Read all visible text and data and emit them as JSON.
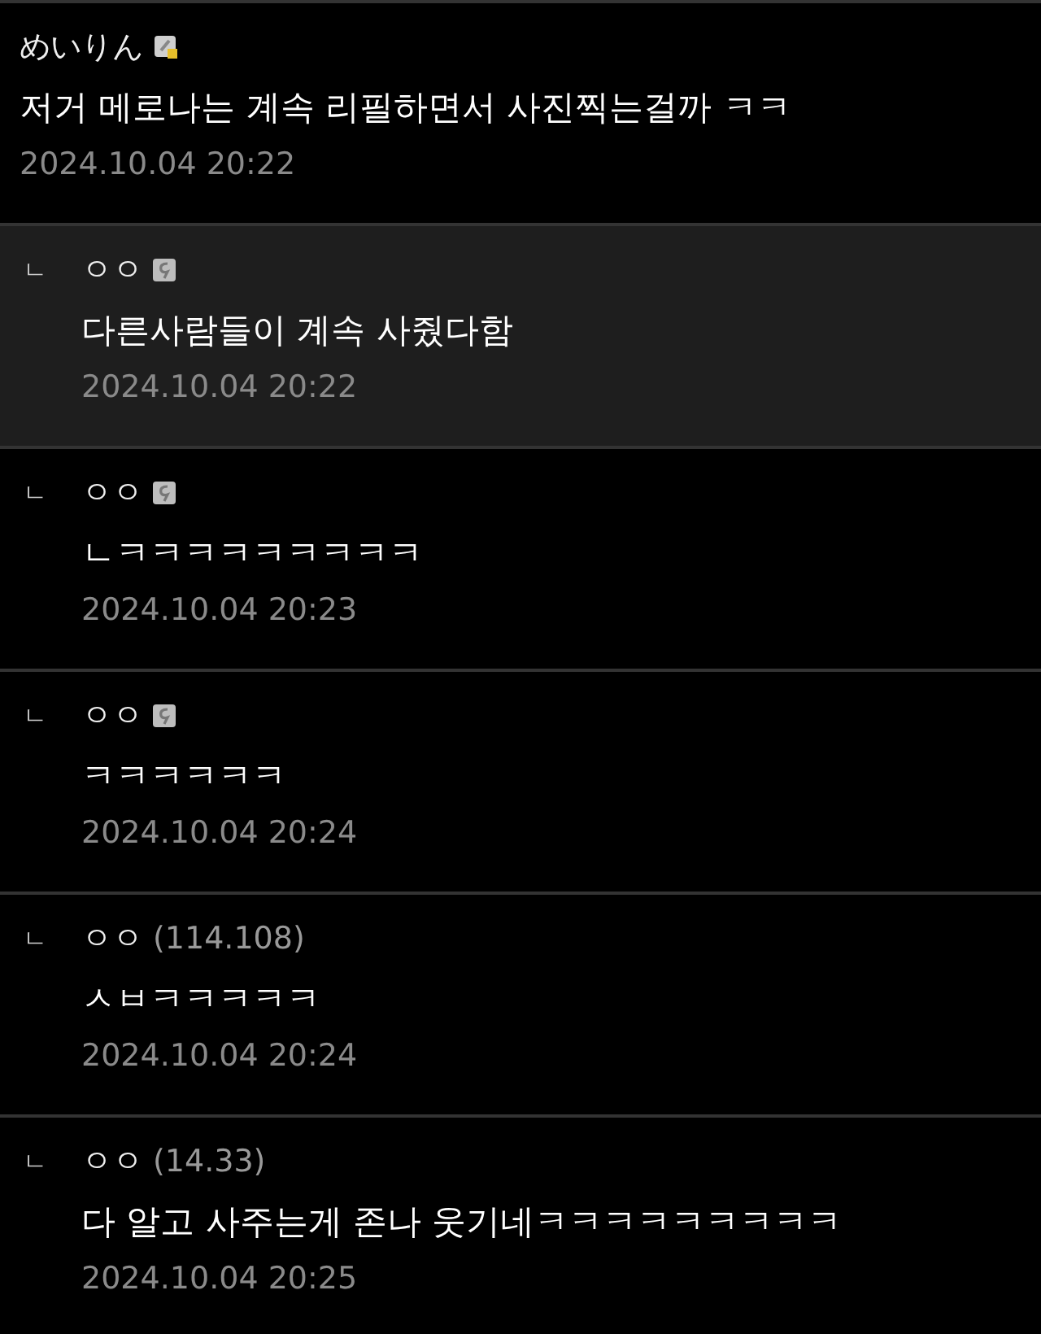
{
  "comment": {
    "nickname": "めいりん",
    "kind": "member",
    "text": "저거 메로나는 계속 리필하면서 사진찍는걸까 ㅋㅋ",
    "date": "2024.10.04 20:22",
    "highlighted": false,
    "children": [
      {
        "marker": "ㄴ",
        "nickname": "ㅇㅇ",
        "kind": "fixed",
        "text": "다른사람들이 계속 사줬다함",
        "date": "2024.10.04 20:22",
        "highlighted": true
      },
      {
        "marker": "ㄴ",
        "nickname": "ㅇㅇ",
        "kind": "fixed",
        "text": "ㄴㅋㅋㅋㅋㅋㅋㅋㅋㅋ",
        "date": "2024.10.04 20:23",
        "highlighted": false
      },
      {
        "marker": "ㄴ",
        "nickname": "ㅇㅇ",
        "kind": "fixed",
        "text": "ㅋㅋㅋㅋㅋㅋ",
        "date": "2024.10.04 20:24",
        "highlighted": false
      },
      {
        "marker": "ㄴ",
        "nickname": "ㅇㅇ",
        "kind": "guest",
        "ip": "(114.108)",
        "text": "ㅅㅂㅋㅋㅋㅋㅋ",
        "date": "2024.10.04 20:24",
        "highlighted": false
      },
      {
        "marker": "ㄴ",
        "nickname": "ㅇㅇ",
        "kind": "guest",
        "ip": "(14.33)",
        "text": "다 알고 사주는게 존나 웃기네ㅋㅋㅋㅋㅋㅋㅋㅋㅋ",
        "date": "2024.10.04 20:25",
        "highlighted": false
      }
    ]
  }
}
